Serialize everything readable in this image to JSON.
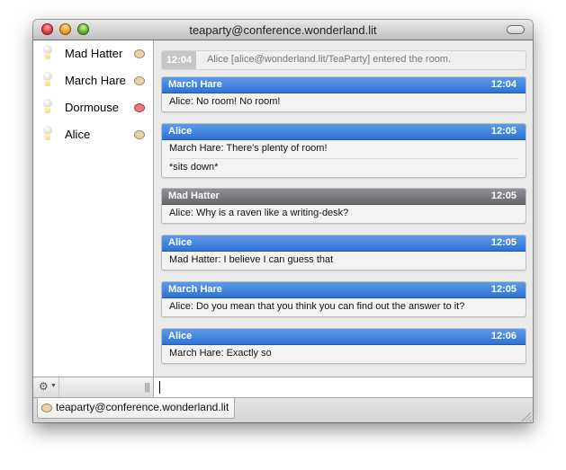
{
  "window": {
    "title": "teaparty@conference.wonderland.lit"
  },
  "participants": [
    {
      "name": "Mad Hatter",
      "status_icon": "speech-bubble-icon",
      "status_color": "#e6d3a8"
    },
    {
      "name": "March Hare",
      "status_icon": "speech-bubble-icon",
      "status_color": "#e6d3a8"
    },
    {
      "name": "Dormouse",
      "status_icon": "speech-bubble-icon",
      "status_color": "#e77a82"
    },
    {
      "name": "Alice",
      "status_icon": "speech-bubble-icon",
      "status_color": "#e6d3a8"
    }
  ],
  "system_message": {
    "time": "12:04",
    "text": "Alice [alice@wonderland.lit/TeaParty] entered the room."
  },
  "messages": [
    {
      "sender": "March Hare",
      "time": "12:04",
      "style": "blue",
      "lines": [
        "Alice: No room! No room!"
      ]
    },
    {
      "sender": "Alice",
      "time": "12:05",
      "style": "blue",
      "lines": [
        "March Hare: There's plenty of room!",
        "*sits down*"
      ]
    },
    {
      "sender": "Mad Hatter",
      "time": "12:05",
      "style": "gray",
      "lines": [
        "Alice: Why is a raven like a writing-desk?"
      ]
    },
    {
      "sender": "Alice",
      "time": "12:05",
      "style": "blue",
      "lines": [
        "Mad Hatter: I believe I can guess that"
      ]
    },
    {
      "sender": "March Hare",
      "time": "12:05",
      "style": "blue",
      "lines": [
        "Alice: Do you mean that you think you can find out the answer to it?"
      ]
    },
    {
      "sender": "Alice",
      "time": "12:06",
      "style": "blue",
      "lines": [
        "March Hare: Exactly so"
      ]
    }
  ],
  "input": {
    "value": "",
    "placeholder": ""
  },
  "sidebar_bottom": {
    "action_icon": "gear-icon",
    "grip_icon": "splitter-grip-icon"
  },
  "tabs": [
    {
      "label": "teaparty@conference.wonderland.lit",
      "icon": "speech-bubble-icon",
      "active": true
    }
  ],
  "colors": {
    "header_blue": "#2f73d6",
    "header_gray": "#66686d",
    "system_time_bg": "#c6c6c6"
  }
}
